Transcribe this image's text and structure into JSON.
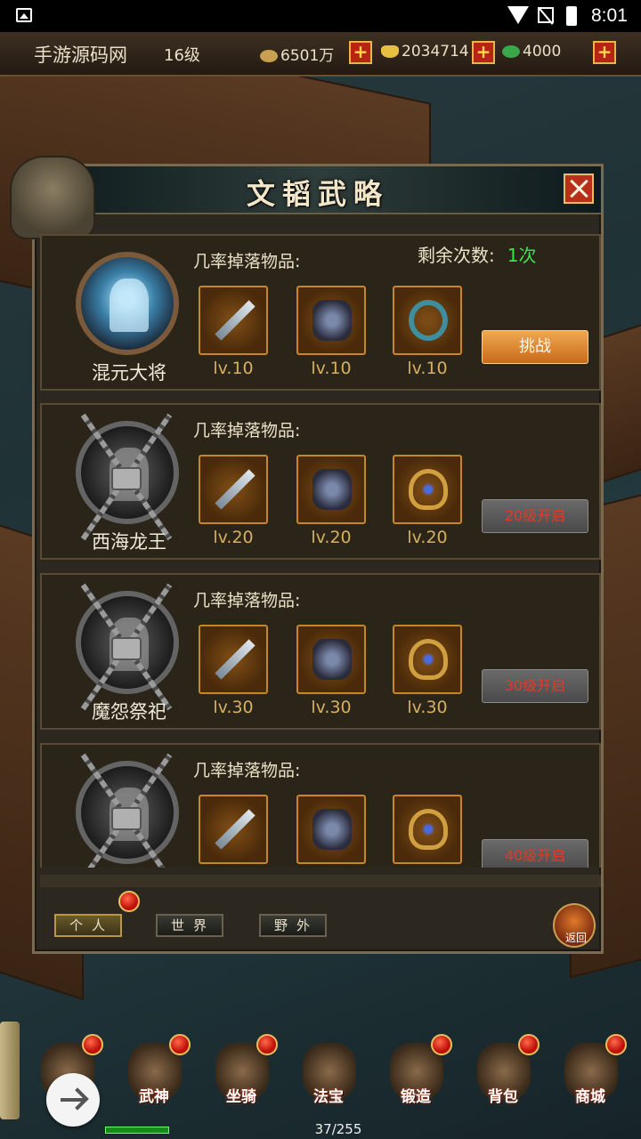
{
  "status_bar": {
    "time": "8:01"
  },
  "player": {
    "name": "手游源码网",
    "level": "16级",
    "coins": "6501万",
    "ingots": "2034714",
    "jade": "4000"
  },
  "panel": {
    "title": "文韬武略",
    "remaining_label": "剩余次数:",
    "remaining_value": "1次",
    "drop_label": "几率掉落物品:",
    "bosses": [
      {
        "name": "混元大将",
        "locked": false,
        "action": "挑战",
        "items": [
          {
            "icon": "sword-icon",
            "level": "lv.10"
          },
          {
            "icon": "armor-icon",
            "level": "lv.10"
          },
          {
            "icon": "ring-icon",
            "level": "lv.10"
          }
        ]
      },
      {
        "name": "西海龙王",
        "locked": true,
        "action": "20级开启",
        "items": [
          {
            "icon": "sword-icon",
            "level": "lv.20"
          },
          {
            "icon": "armor-icon",
            "level": "lv.20"
          },
          {
            "icon": "amulet-icon",
            "level": "lv.20"
          }
        ]
      },
      {
        "name": "魔怨祭祀",
        "locked": true,
        "action": "30级开启",
        "items": [
          {
            "icon": "sword-icon",
            "level": "lv.30"
          },
          {
            "icon": "armor-icon",
            "level": "lv.30"
          },
          {
            "icon": "amulet-icon",
            "level": "lv.30"
          }
        ]
      },
      {
        "name": "",
        "locked": true,
        "action": "40级开启",
        "items": [
          {
            "icon": "sword-icon",
            "level": ""
          },
          {
            "icon": "armor-icon",
            "level": ""
          },
          {
            "icon": "amulet-icon",
            "level": ""
          }
        ]
      }
    ],
    "tabs": [
      "个人",
      "世界",
      "野外"
    ],
    "back_label": "返回"
  },
  "bottom_nav": [
    "",
    "武神",
    "坐骑",
    "法宝",
    "锻造",
    "背包",
    "商城"
  ],
  "progress_text": "37/255",
  "colors": {
    "accent": "#c86a1a",
    "remaining": "#3ee24a",
    "locked_text": "#e23a2a",
    "level_text": "#d6b060"
  }
}
